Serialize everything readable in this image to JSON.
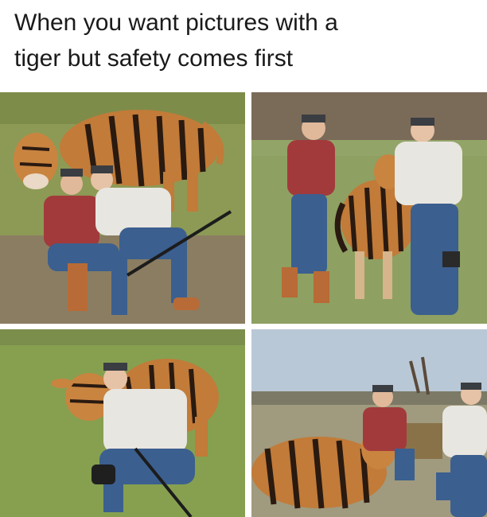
{
  "meme": {
    "caption_line1": "When you want pictures with a",
    "caption_line2": "tiger but safety comes first"
  },
  "colors": {
    "grass": "#8a9a52",
    "dirt": "#8b7a5e",
    "cow_orange": "#c07a36",
    "stripe": "#2a1a10",
    "jeans": "#3b5f8f",
    "red_shirt": "#a23a3c",
    "white_shirt": "#e8e6e0",
    "sky": "#b9c8d6"
  }
}
